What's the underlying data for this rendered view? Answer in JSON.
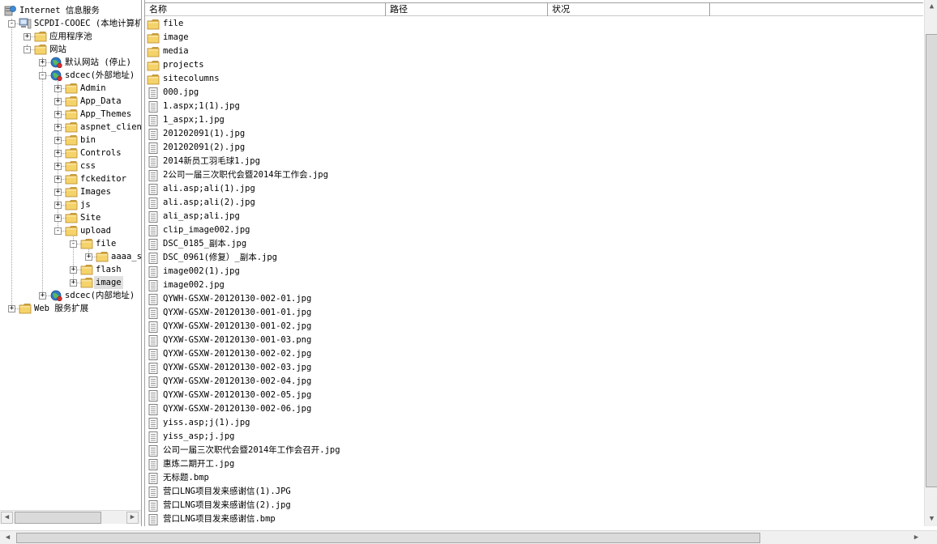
{
  "tree": {
    "nodes": [
      {
        "label": "Internet 信息服务",
        "icon": "iis-server-icon",
        "expander": "",
        "depth": 0,
        "selected": false
      },
      {
        "label": "SCPDI-COOEC (本地计算机)",
        "icon": "computer-icon",
        "expander": "-",
        "depth": 1,
        "selected": false
      },
      {
        "label": "应用程序池",
        "icon": "folder-icon",
        "expander": "+",
        "depth": 2,
        "selected": false
      },
      {
        "label": "网站",
        "icon": "folder-icon",
        "expander": "-",
        "depth": 2,
        "selected": false
      },
      {
        "label": "默认网站 (停止)",
        "icon": "website-stopped-icon",
        "expander": "+",
        "depth": 3,
        "selected": false
      },
      {
        "label": "sdcec(外部地址)",
        "icon": "website-icon",
        "expander": "-",
        "depth": 3,
        "selected": false
      },
      {
        "label": "Admin",
        "icon": "folder-icon",
        "expander": "+",
        "depth": 4,
        "selected": false
      },
      {
        "label": "App_Data",
        "icon": "folder-icon",
        "expander": "+",
        "depth": 4,
        "selected": false
      },
      {
        "label": "App_Themes",
        "icon": "folder-icon",
        "expander": "+",
        "depth": 4,
        "selected": false
      },
      {
        "label": "aspnet_client",
        "icon": "folder-icon",
        "expander": "+",
        "depth": 4,
        "selected": false
      },
      {
        "label": "bin",
        "icon": "folder-icon",
        "expander": "+",
        "depth": 4,
        "selected": false
      },
      {
        "label": "Controls",
        "icon": "folder-icon",
        "expander": "+",
        "depth": 4,
        "selected": false
      },
      {
        "label": "css",
        "icon": "folder-icon",
        "expander": "+",
        "depth": 4,
        "selected": false
      },
      {
        "label": "fckeditor",
        "icon": "folder-icon",
        "expander": "+",
        "depth": 4,
        "selected": false
      },
      {
        "label": "Images",
        "icon": "folder-icon",
        "expander": "+",
        "depth": 4,
        "selected": false
      },
      {
        "label": "js",
        "icon": "folder-icon",
        "expander": "+",
        "depth": 4,
        "selected": false
      },
      {
        "label": "Site",
        "icon": "folder-icon",
        "expander": "+",
        "depth": 4,
        "selected": false
      },
      {
        "label": "upload",
        "icon": "folder-icon",
        "expander": "-",
        "depth": 4,
        "selected": false
      },
      {
        "label": "file",
        "icon": "folder-icon",
        "expander": "-",
        "depth": 5,
        "selected": false
      },
      {
        "label": "aaaa_s",
        "icon": "folder-icon",
        "expander": "+",
        "depth": 6,
        "selected": false
      },
      {
        "label": "flash",
        "icon": "folder-icon",
        "expander": "+",
        "depth": 5,
        "selected": false
      },
      {
        "label": "image",
        "icon": "folder-icon",
        "expander": "+",
        "depth": 5,
        "selected": true
      },
      {
        "label": "sdcec(内部地址)",
        "icon": "website-icon",
        "expander": "+",
        "depth": 3,
        "selected": false
      },
      {
        "label": "Web 服务扩展",
        "icon": "folder-icon",
        "expander": "+",
        "depth": 1,
        "selected": false
      }
    ]
  },
  "list": {
    "columns": [
      "名称",
      "路径",
      "状况"
    ],
    "items": [
      {
        "name": "file",
        "icon": "folder-icon"
      },
      {
        "name": "image",
        "icon": "folder-icon"
      },
      {
        "name": "media",
        "icon": "folder-icon"
      },
      {
        "name": "projects",
        "icon": "folder-icon"
      },
      {
        "name": "sitecolumns",
        "icon": "folder-icon"
      },
      {
        "name": "000.jpg",
        "icon": "file-icon"
      },
      {
        "name": "1.aspx;1(1).jpg",
        "icon": "file-icon"
      },
      {
        "name": "1_aspx;1.jpg",
        "icon": "file-icon"
      },
      {
        "name": "201202091(1).jpg",
        "icon": "file-icon"
      },
      {
        "name": "201202091(2).jpg",
        "icon": "file-icon"
      },
      {
        "name": "2014新员工羽毛球1.jpg",
        "icon": "file-icon"
      },
      {
        "name": "2公司一届三次职代会暨2014年工作会.jpg",
        "icon": "file-icon"
      },
      {
        "name": "ali.asp;ali(1).jpg",
        "icon": "file-icon"
      },
      {
        "name": "ali.asp;ali(2).jpg",
        "icon": "file-icon"
      },
      {
        "name": "ali_asp;ali.jpg",
        "icon": "file-icon"
      },
      {
        "name": "clip_image002.jpg",
        "icon": "file-icon"
      },
      {
        "name": "DSC_0185_副本.jpg",
        "icon": "file-icon"
      },
      {
        "name": "DSC_0961(修复）_副本.jpg",
        "icon": "file-icon"
      },
      {
        "name": "image002(1).jpg",
        "icon": "file-icon"
      },
      {
        "name": "image002.jpg",
        "icon": "file-icon"
      },
      {
        "name": "QYWH-GSXW-20120130-002-01.jpg",
        "icon": "file-icon"
      },
      {
        "name": "QYXW-GSXW-20120130-001-01.jpg",
        "icon": "file-icon"
      },
      {
        "name": "QYXW-GSXW-20120130-001-02.jpg",
        "icon": "file-icon"
      },
      {
        "name": "QYXW-GSXW-20120130-001-03.png",
        "icon": "file-icon"
      },
      {
        "name": "QYXW-GSXW-20120130-002-02.jpg",
        "icon": "file-icon"
      },
      {
        "name": "QYXW-GSXW-20120130-002-03.jpg",
        "icon": "file-icon"
      },
      {
        "name": "QYXW-GSXW-20120130-002-04.jpg",
        "icon": "file-icon"
      },
      {
        "name": "QYXW-GSXW-20120130-002-05.jpg",
        "icon": "file-icon"
      },
      {
        "name": "QYXW-GSXW-20120130-002-06.jpg",
        "icon": "file-icon"
      },
      {
        "name": "yiss.asp;j(1).jpg",
        "icon": "file-icon"
      },
      {
        "name": "yiss_asp;j.jpg",
        "icon": "file-icon"
      },
      {
        "name": "公司一届三次职代会暨2014年工作会召开.jpg",
        "icon": "file-icon"
      },
      {
        "name": "惠炼二期开工.jpg",
        "icon": "file-icon"
      },
      {
        "name": "无标题.bmp",
        "icon": "file-icon"
      },
      {
        "name": "营口LNG项目发来感谢信(1).JPG",
        "icon": "file-icon"
      },
      {
        "name": "营口LNG项目发来感谢信(2).jpg",
        "icon": "file-icon"
      },
      {
        "name": "营口LNG项目发来感谢信.bmp",
        "icon": "file-icon"
      }
    ]
  },
  "scrollbars": {
    "left_arrow": "◀",
    "right_arrow": "▶",
    "up_arrow": "▲",
    "down_arrow": "▼"
  },
  "colors": {
    "folder": "#f5d36b",
    "folder_dark": "#d9a93b",
    "selection": "#e0e0e0"
  }
}
